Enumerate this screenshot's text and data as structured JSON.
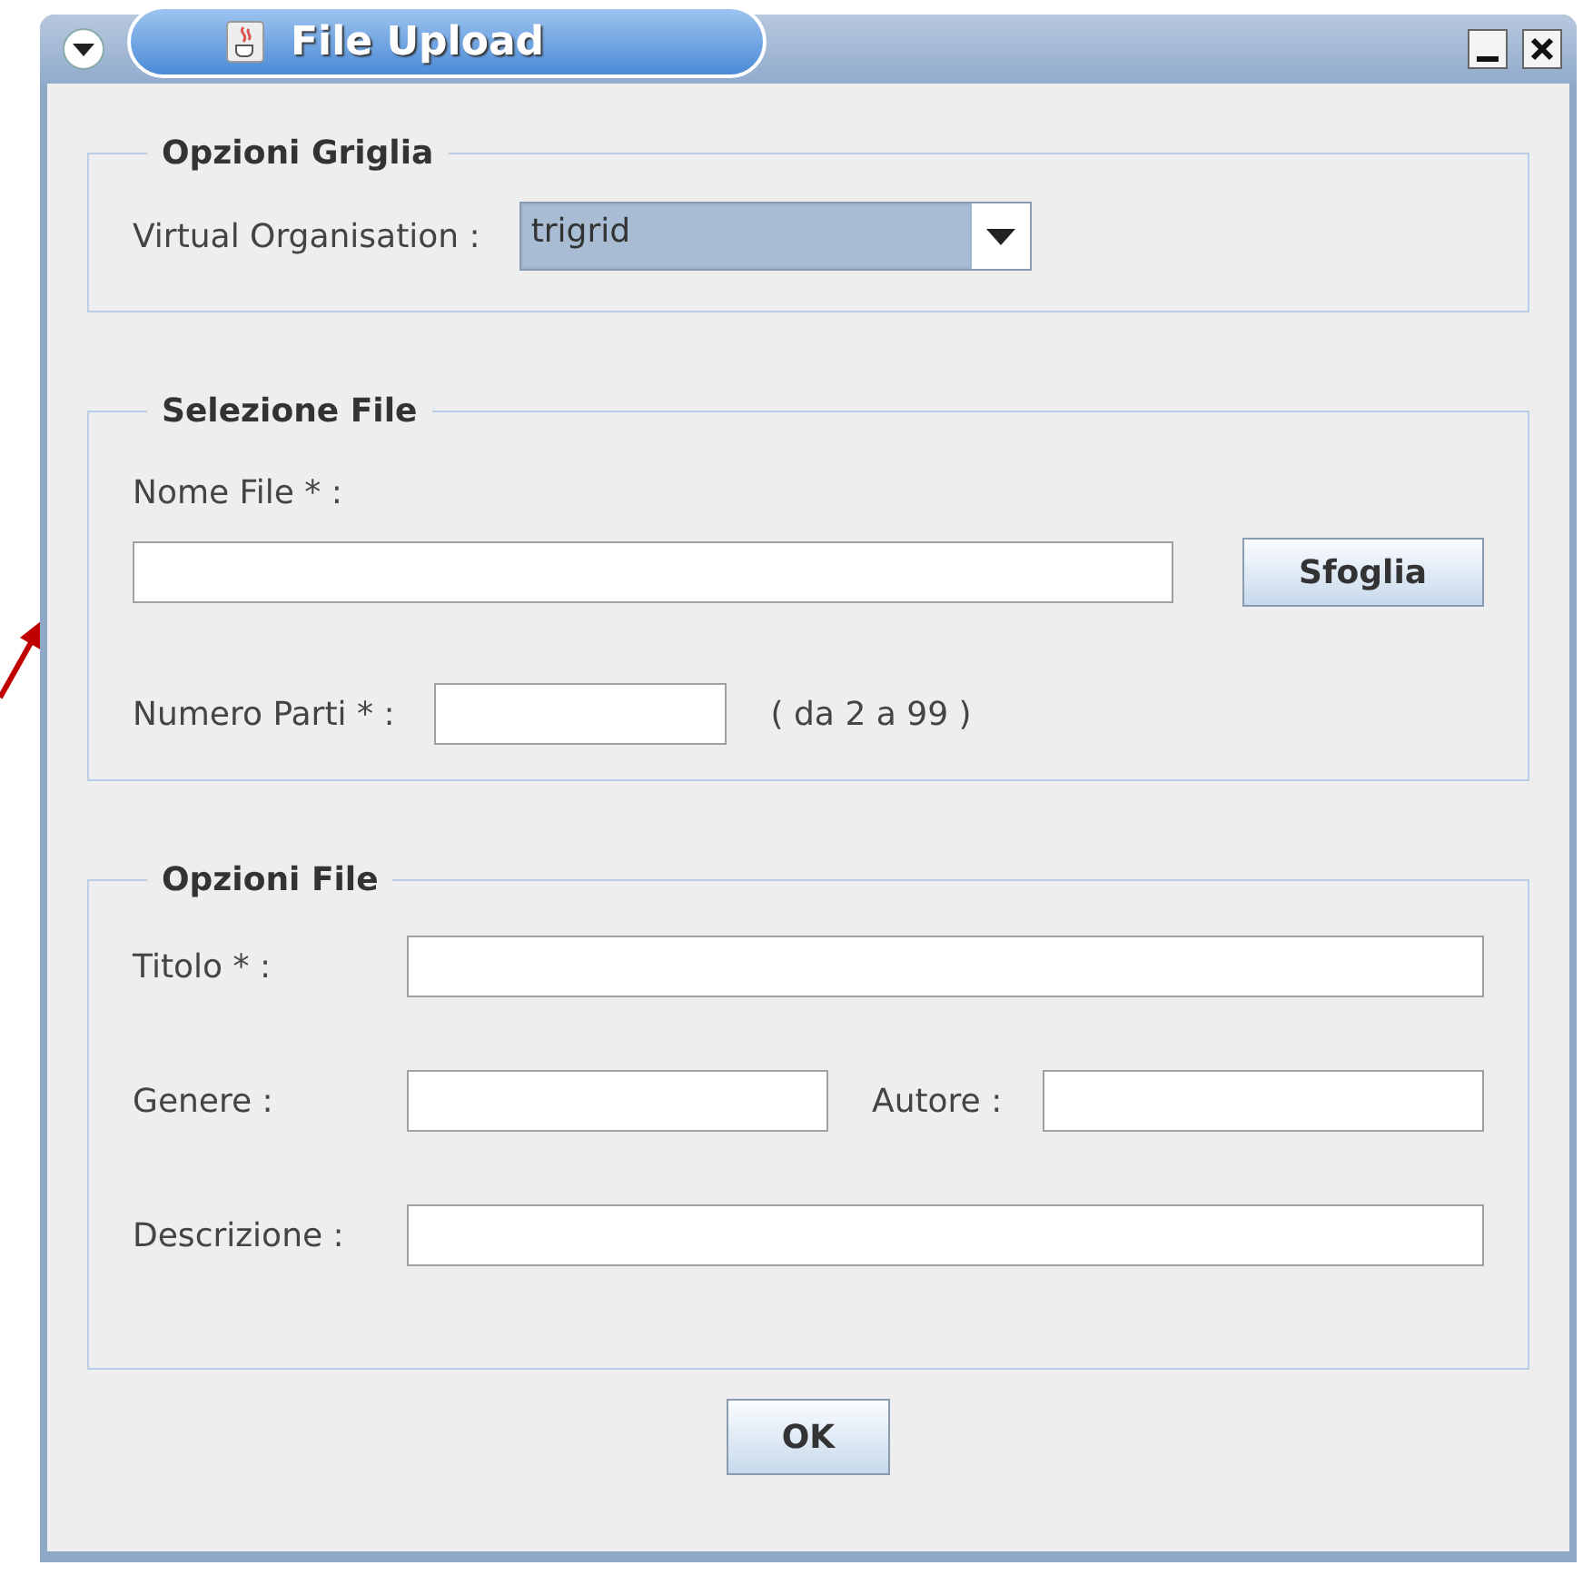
{
  "window": {
    "title": "File Upload"
  },
  "grid_options": {
    "title": "Opzioni Griglia",
    "vo_label": "Virtual Organisation :",
    "vo_value": "trigrid"
  },
  "file_selection": {
    "title": "Selezione File",
    "file_label": "Nome File * :",
    "browse_button": "Sfoglia",
    "parts_label": "Numero Parti * :",
    "parts_hint": "( da 2 a 99 )"
  },
  "file_options": {
    "title": "Opzioni File",
    "title_label": "Titolo * :",
    "genre_label": "Genere :",
    "author_label": "Autore :",
    "description_label": "Descrizione :"
  },
  "buttons": [
    "OK"
  ]
}
